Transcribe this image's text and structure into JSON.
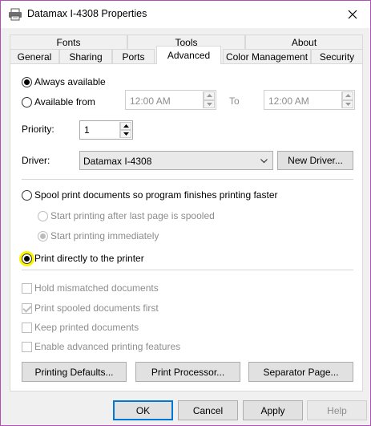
{
  "window": {
    "title": "Datamax I-4308 Properties"
  },
  "tabs": {
    "row1": [
      "Fonts",
      "Tools",
      "About"
    ],
    "row2": [
      "General",
      "Sharing",
      "Ports",
      "Advanced",
      "Color Management",
      "Security"
    ],
    "active": "Advanced"
  },
  "availability": {
    "always_label": "Always available",
    "from_label": "Available from",
    "from_time": "12:00 AM",
    "to_label": "To",
    "to_time": "12:00 AM",
    "selected": "always"
  },
  "priority": {
    "label": "Priority:",
    "value": "1"
  },
  "driver": {
    "label": "Driver:",
    "value": "Datamax I-4308",
    "new_driver_label": "New Driver..."
  },
  "spooling": {
    "spool_label": "Spool print documents so program finishes printing faster",
    "after_last_page_label": "Start printing after last page is spooled",
    "immediately_label": "Start printing immediately",
    "direct_label": "Print directly to the printer",
    "selected": "direct"
  },
  "options": {
    "hold_mismatched": {
      "label": "Hold mismatched documents",
      "checked": false
    },
    "spooled_first": {
      "label": "Print spooled documents first",
      "checked": true
    },
    "keep_printed": {
      "label": "Keep printed documents",
      "checked": false
    },
    "advanced_features": {
      "label": "Enable advanced printing features",
      "checked": false
    }
  },
  "panel_buttons": {
    "printing_defaults": "Printing Defaults...",
    "print_processor": "Print Processor...",
    "separator_page": "Separator Page..."
  },
  "dialog_buttons": {
    "ok": "OK",
    "cancel": "Cancel",
    "apply": "Apply",
    "help": "Help"
  },
  "colors": {
    "highlight": "#fff200",
    "default_button_border": "#0078d7",
    "window_border": "#b04fb5"
  }
}
